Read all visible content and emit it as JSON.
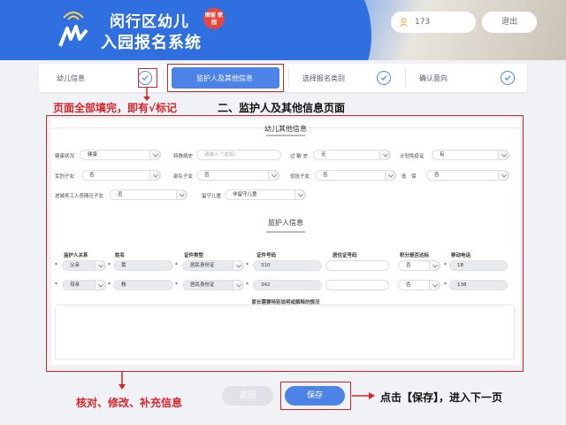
{
  "header": {
    "title_line1": "闵行区幼儿",
    "title_line2": "入园报名系统",
    "badge": "图留 家园",
    "user_id": "173",
    "logout_label": "退出"
  },
  "steps": [
    {
      "label": "幼儿信息",
      "done": true
    },
    {
      "label": "监护人及其他信息",
      "done": true
    },
    {
      "label": "选择报名类别",
      "done": true
    },
    {
      "label": "确认意向",
      "done": true
    }
  ],
  "annotations": {
    "fill_note": "页面全部填完，即有√标记",
    "page_note": "二、监护人及其他信息页面",
    "check_note": "核对、修改、补充信息",
    "save_note": "点击【保存】，进入下一页"
  },
  "form": {
    "other_title": "幼儿其他信息",
    "guardian_title": "监护人信息",
    "other_fields": [
      {
        "label": "健康状况",
        "value": "健康"
      },
      {
        "label": "特殊病史",
        "value": "",
        "placeholder": "请输入（选填）"
      },
      {
        "label": "过 敏 史",
        "value": "无"
      },
      {
        "label": "计划免疫证",
        "value": "有"
      },
      {
        "label": "军烈子女",
        "value": "否"
      },
      {
        "label": "部队子女",
        "value": "否"
      },
      {
        "label": "优抚子女",
        "value": "否"
      },
      {
        "label": "低　保",
        "value": "否"
      },
      {
        "label": "进城务工人员随迁子女",
        "value": "否"
      },
      {
        "label": "留守儿童",
        "value": "非留守儿童"
      }
    ],
    "guardian_headers": [
      "监护人关系",
      "姓名",
      "证件类型",
      "证件号码",
      "居住证号码",
      "积分是否达标",
      "移动电话"
    ],
    "guardians": [
      {
        "relation": "父亲",
        "name": "黄",
        "id_type": "居民身份证",
        "id_no": "310",
        "residence": "",
        "points": "否",
        "phone": "18"
      },
      {
        "relation": "母亲",
        "name": "杨",
        "id_type": "居民身份证",
        "id_no": "342",
        "residence": "",
        "points": "否",
        "phone": "138"
      }
    ],
    "remarks_label": "家长需要特别说明或解释的情况"
  },
  "buttons": {
    "back": "返回",
    "save": "保存"
  },
  "colors": {
    "brand": "#2f6fe0",
    "accent": "#4d82e6",
    "annotation_red": "#d9232a"
  }
}
